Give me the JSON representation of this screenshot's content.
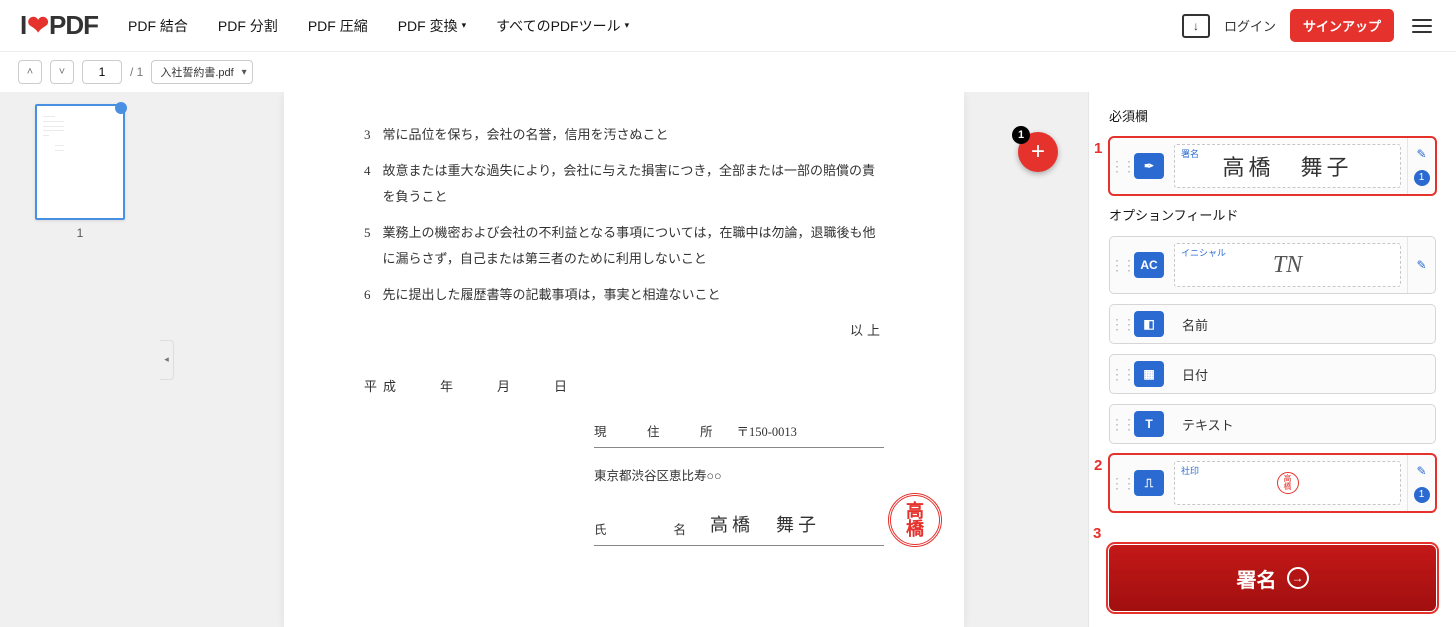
{
  "header": {
    "logo_pre": "I",
    "logo_heart": "❤",
    "logo_post": "PDF",
    "nav": [
      "PDF 結合",
      "PDF 分割",
      "PDF 圧縮",
      "PDF 変換",
      "すべてのPDFツール"
    ],
    "login": "ログイン",
    "signup": "サインアップ"
  },
  "toolbar": {
    "page_current": "1",
    "page_total": "/ 1",
    "file_name": "入社誓約書.pdf"
  },
  "thumbs": {
    "label": "1"
  },
  "fab": {
    "badge": "1"
  },
  "document": {
    "items": [
      {
        "n": "3",
        "text": "常に品位を保ち，会社の名誉，信用を汚さぬこと"
      },
      {
        "n": "4",
        "text": "故意または重大な過失により，会社に与えた損害につき，全部または一部の賠償の責を負うこと"
      },
      {
        "n": "5",
        "text": "業務上の機密および会社の不利益となる事項については，在職中は勿論，退職後も他に漏らさず，自己または第三者のために利用しないこと"
      },
      {
        "n": "6",
        "text": "先に提出した履歴書等の記載事項は，事実と相違ないこと"
      }
    ],
    "ijou": "以上",
    "date_line": "平成　　年　　月　　日",
    "addr_label": "現　住　所",
    "addr_post": "〒150-0013",
    "addr_line": "東京都渋谷区恵比寿○○",
    "name_label": "氏　　名",
    "name_value": "高橋　舞子",
    "hanko1": "高",
    "hanko2": "橋"
  },
  "panel": {
    "required_title": "必須欄",
    "optional_title": "オプションフィールド",
    "signature": {
      "tiny": "署名",
      "value": "高橋　舞子",
      "count": "1"
    },
    "initials": {
      "tiny": "イニシャル",
      "value": "TN",
      "icon": "AC"
    },
    "name_field": "名前",
    "date_field": "日付",
    "text_field": "テキスト",
    "stamp": {
      "tiny": "社印",
      "h1": "高",
      "h2": "橋",
      "count": "1"
    },
    "cta": "署名",
    "annot1": "1",
    "annot2": "2",
    "annot3": "3"
  }
}
